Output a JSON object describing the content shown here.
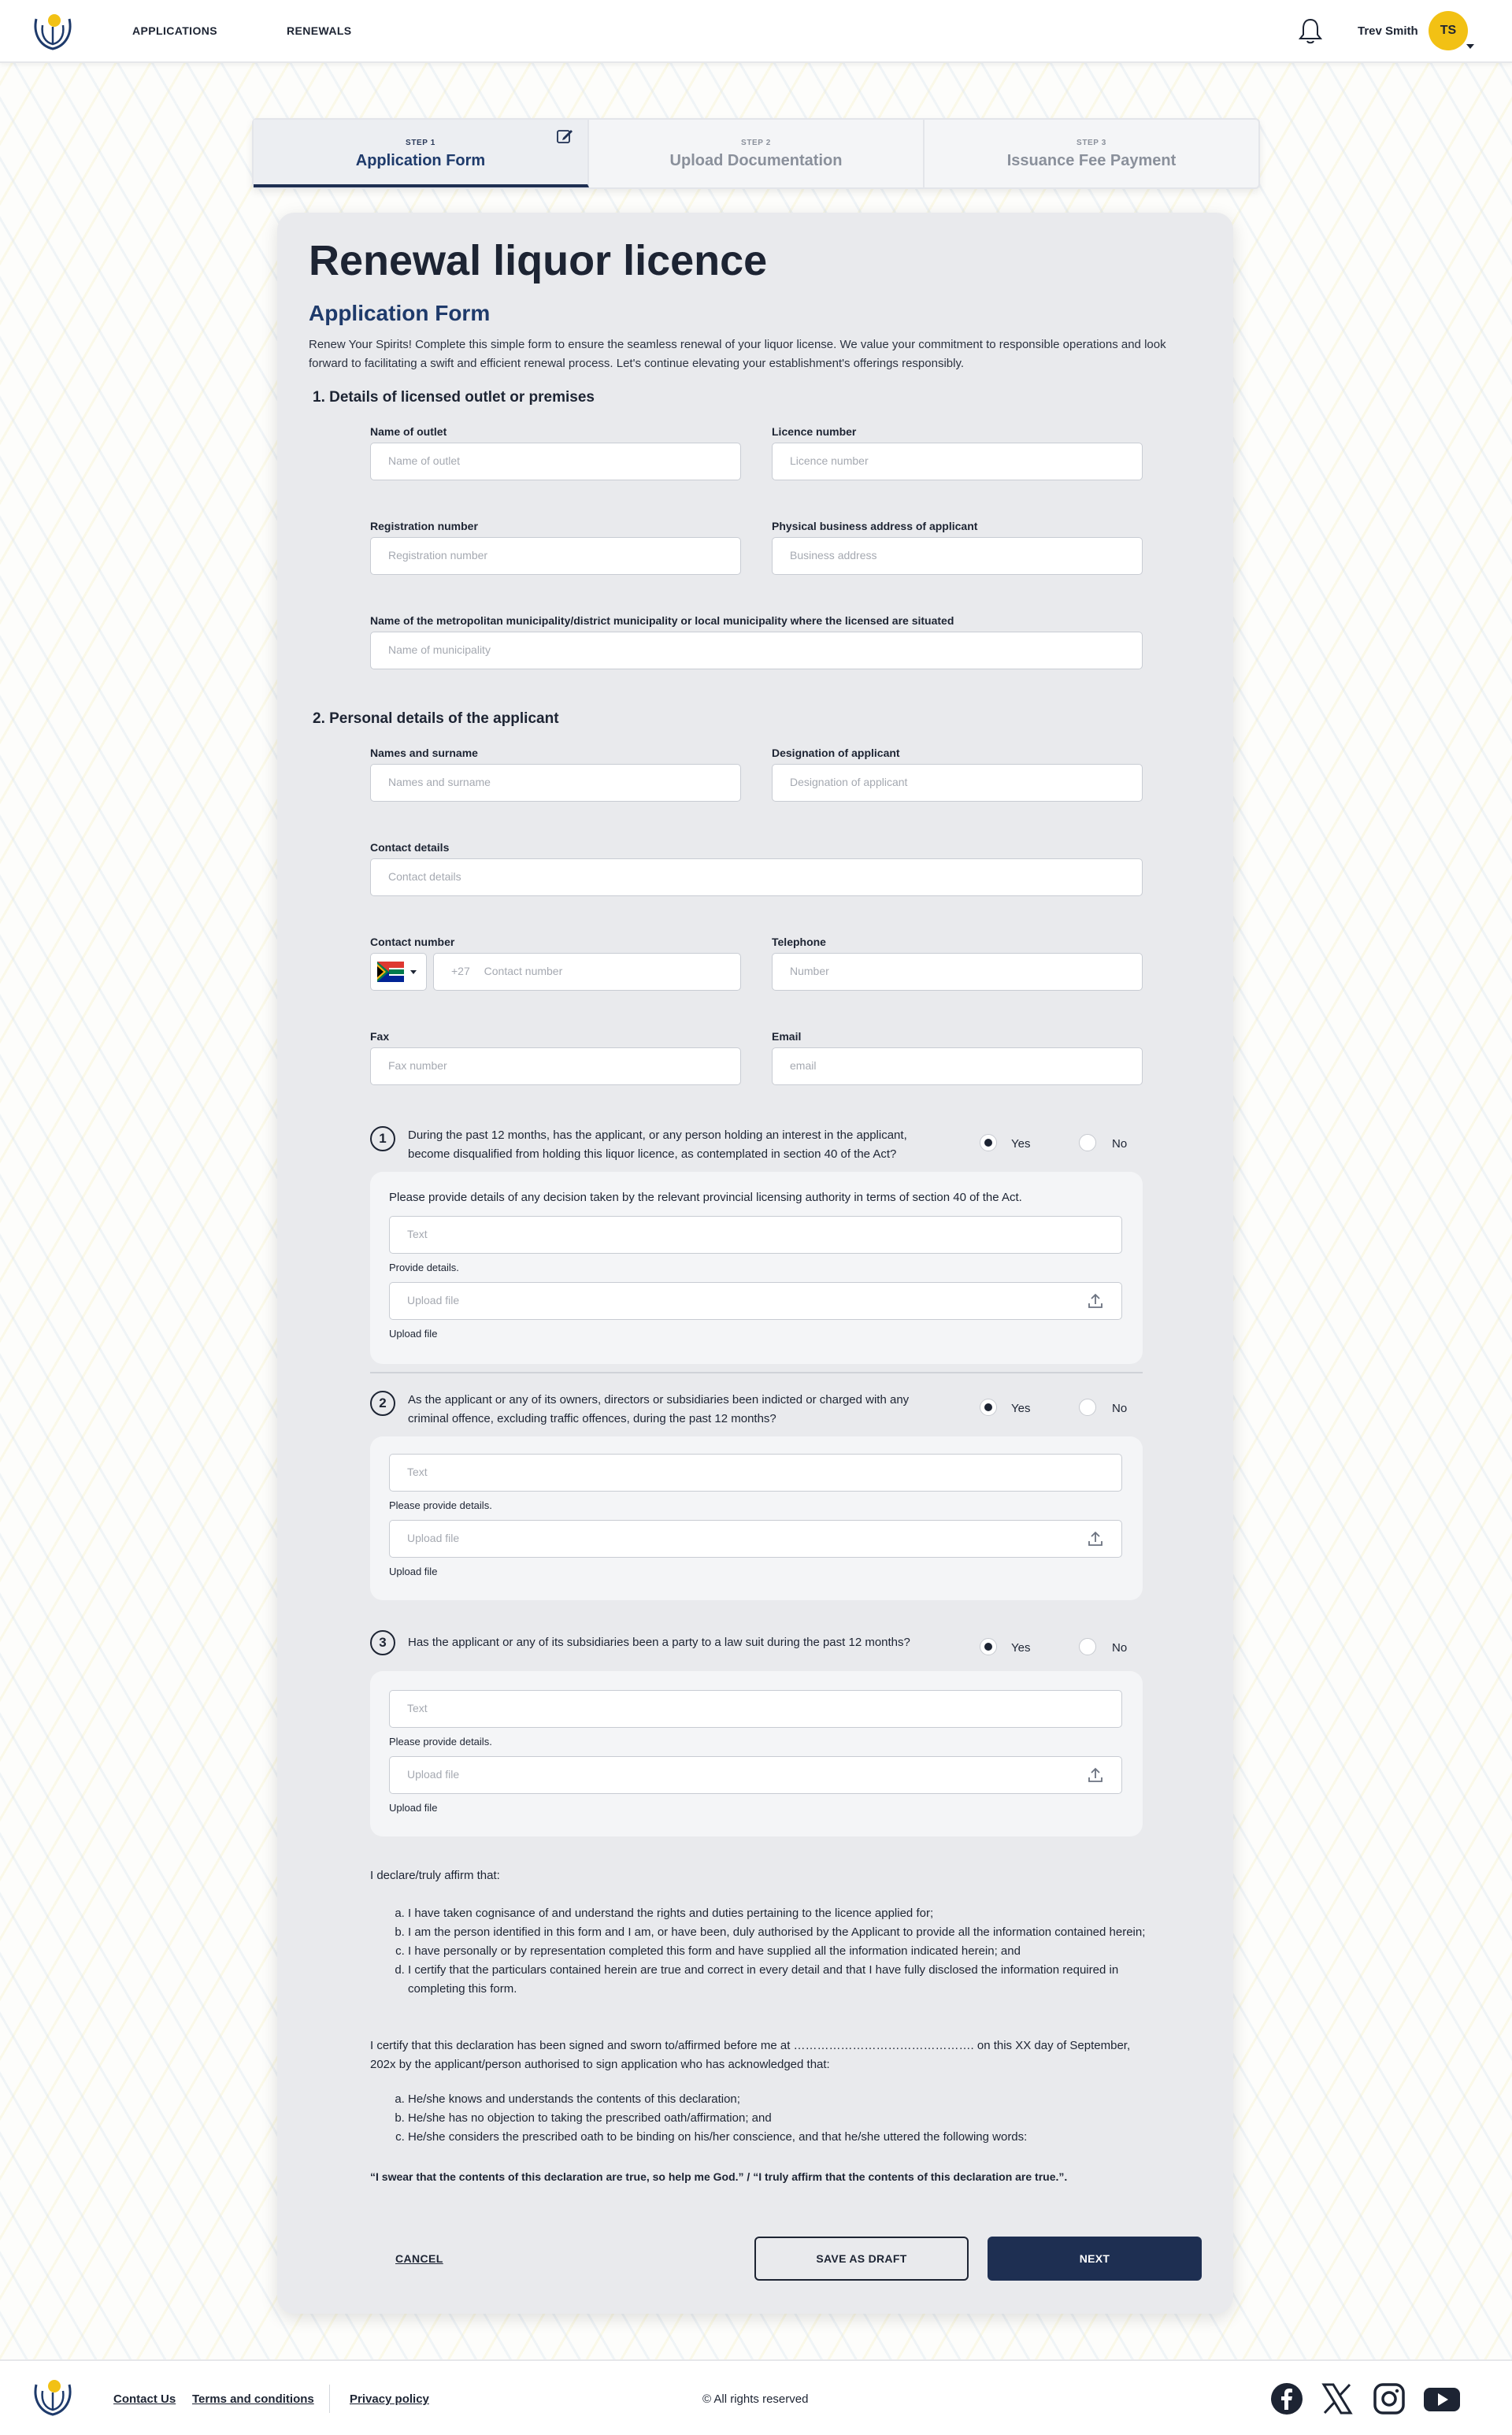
{
  "header": {
    "nav": [
      "APPLICATIONS",
      "RENEWALS"
    ],
    "user_name": "Trev Smith",
    "avatar_initials": "TS"
  },
  "steps": [
    {
      "num": "STEP 1",
      "title": "Application Form"
    },
    {
      "num": "STEP 2",
      "title": "Upload Documentation"
    },
    {
      "num": "STEP 3",
      "title": "Issuance Fee Payment"
    }
  ],
  "form": {
    "title": "Renewal liquor licence",
    "subtitle": "Application Form",
    "intro": "Renew Your Spirits! Complete this simple form to ensure the seamless renewal of your liquor license. We value your commitment to responsible operations and look forward to facilitating a swift and efficient renewal process. Let's continue elevating your establishment's offerings responsibly.",
    "section1": {
      "title": "1. Details of licensed outlet or premises",
      "outlet_label": "Name of outlet",
      "outlet_placeholder": "Name of outlet",
      "licence_label": "Licence number",
      "licence_placeholder": "Licence number",
      "reg_label": "Registration number",
      "reg_placeholder": "Registration number",
      "address_label": "Physical business address of applicant",
      "address_placeholder": "Business address",
      "municipality_label": "Name of the metropolitan municipality/district municipality or local municipality where the licensed are situated",
      "municipality_placeholder": "Name of municipality"
    },
    "section2": {
      "title": "2. Personal details of the applicant",
      "names_label": "Names and surname",
      "names_placeholder": "Names and surname",
      "designation_label": "Designation of applicant",
      "designation_placeholder": "Designation of applicant",
      "contact_details_label": "Contact details",
      "contact_details_placeholder": "Contact details",
      "contact_number_label": "Contact number",
      "country_code": "+27",
      "contact_number_placeholder": "Contact number",
      "telephone_label": "Telephone",
      "telephone_placeholder": "Number",
      "fax_label": "Fax",
      "fax_placeholder": "Fax number",
      "email_label": "Email",
      "email_placeholder": "email"
    },
    "questions": [
      {
        "num": "1",
        "text": "During the past 12 months, has the applicant, or any person holding an interest in the applicant, become disqualified from holding this liquor licence, as contemplated in section 40 of the Act?",
        "panel_intro": "Please provide details of any decision taken by the relevant provincial licensing authority in terms of section 40 of the Act.",
        "text_placeholder": "Text",
        "text_help": "Provide details.",
        "upload_placeholder": "Upload file",
        "upload_help": "Upload file",
        "answer": "Yes"
      },
      {
        "num": "2",
        "text": "As the applicant or any of its owners, directors or subsidiaries been indicted or charged with any criminal offence, excluding traffic offences, during the past 12 months?",
        "text_placeholder": "Text",
        "text_help": "Please provide details.",
        "upload_placeholder": "Upload file",
        "upload_help": "Upload file",
        "answer": "Yes"
      },
      {
        "num": "3",
        "text": "Has the applicant or any of its subsidiaries been a party to a law suit  during the past 12 months?",
        "text_placeholder": "Text",
        "text_help": "Please provide details.",
        "upload_placeholder": "Upload file",
        "upload_help": "Upload file",
        "answer": "Yes"
      }
    ],
    "yes_label": "Yes",
    "no_label": "No",
    "declaration": {
      "intro": "I declare/truly affirm that:",
      "items": [
        "I have taken cognisance of and understand the rights and duties pertaining to the licence applied for;",
        "I am the person identified in this form and I am, or have been, duly authorised by the Applicant to provide all the information contained herein;",
        "I have personally or by representation completed this form and have supplied all the information indicated herein; and",
        "I certify that the particulars contained herein are true and correct in every detail and that I have fully disclosed the information required in completing this form."
      ],
      "certify": "I certify that this declaration has been signed and sworn to/affirmed before me at ………………………………………. on this XX day of September, 202x by the applicant/person authorised to sign application who has acknowledged that:",
      "items2": [
        "He/she knows and understands the contents of this declaration;",
        "He/she has no objection to taking the prescribed oath/affirmation; and",
        "He/she considers the prescribed oath to be binding on his/her conscience, and that he/she uttered the following words:"
      ],
      "oath": "“I swear that the contents of this declaration are true, so help me God.” / “I truly affirm that the contents of this declaration are true.”."
    },
    "buttons": {
      "cancel": "CANCEL",
      "draft": "SAVE AS DRAFT",
      "next": "NEXT"
    }
  },
  "footer": {
    "links": [
      "Contact Us",
      "Terms and conditions",
      "Privacy policy"
    ],
    "copyright": "© All rights reserved",
    "social_icons": [
      "facebook-icon",
      "x-icon",
      "instagram-icon",
      "youtube-icon"
    ]
  },
  "colors": {
    "primary": "#1e2f52",
    "accent": "#f2c114",
    "card": "#e9eaed"
  }
}
